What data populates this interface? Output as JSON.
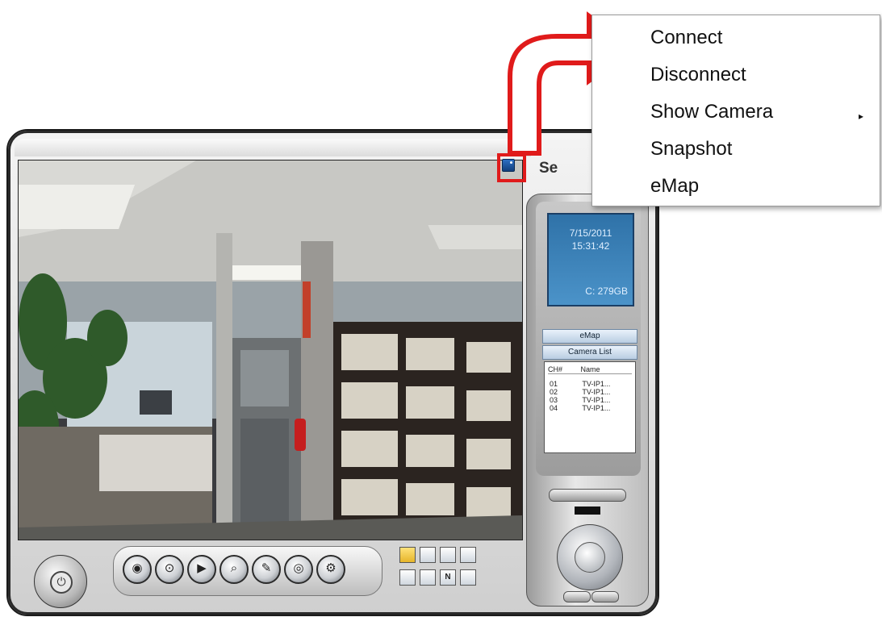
{
  "app": {
    "title_partial": "Se"
  },
  "status_screen": {
    "date": "7/15/2011",
    "time": "15:31:42",
    "disk": "C: 279GB"
  },
  "side_buttons": {
    "emap": "eMap",
    "camera_list": "Camera List"
  },
  "camera_list": {
    "headers": [
      "CH#",
      "Name"
    ],
    "rows": [
      {
        "ch": "01",
        "name": "TV-IP1..."
      },
      {
        "ch": "02",
        "name": "TV-IP1..."
      },
      {
        "ch": "03",
        "name": "TV-IP1..."
      },
      {
        "ch": "04",
        "name": "TV-IP1..."
      }
    ]
  },
  "context_menu": {
    "items": [
      "Connect",
      "Disconnect",
      "Show Camera",
      "Snapshot",
      "eMap"
    ],
    "submenu_indicator": "▸"
  },
  "layout_buttons": [
    "",
    "",
    "",
    "",
    "",
    "",
    "N",
    ""
  ],
  "colors": {
    "highlight": "#e01b1b",
    "screen": "#3b82bd"
  }
}
